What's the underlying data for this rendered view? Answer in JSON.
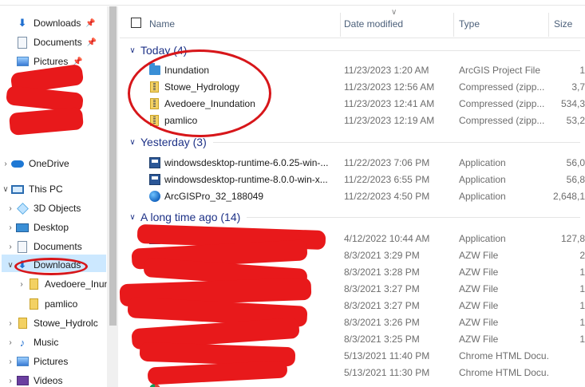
{
  "navigation": {
    "quick_access": [
      {
        "label": "Downloads",
        "icon": "download-arrow-icon",
        "pinned": true
      },
      {
        "label": "Documents",
        "icon": "document-icon",
        "pinned": true
      },
      {
        "label": "Pictures",
        "icon": "picture-icon",
        "pinned": true
      }
    ],
    "onedrive": {
      "label": "OneDrive",
      "icon": "cloud-icon"
    },
    "this_pc": {
      "label": "This PC",
      "icon": "computer-icon"
    },
    "this_pc_items": [
      {
        "label": "3D Objects",
        "icon": "cube-icon"
      },
      {
        "label": "Desktop",
        "icon": "desktop-icon"
      },
      {
        "label": "Documents",
        "icon": "document-icon"
      },
      {
        "label": "Downloads",
        "icon": "download-arrow-icon",
        "selected": true
      },
      {
        "label": "Avedoere_Inun",
        "icon": "zip-folder-icon"
      },
      {
        "label": "pamlico",
        "icon": "zip-folder-icon"
      },
      {
        "label": "Stowe_Hydrolc",
        "icon": "zip-folder-icon"
      },
      {
        "label": "Music",
        "icon": "music-note-icon"
      },
      {
        "label": "Pictures",
        "icon": "picture-icon"
      },
      {
        "label": "Videos",
        "icon": "video-icon"
      }
    ]
  },
  "columns": {
    "name": "Name",
    "date_modified": "Date modified",
    "type": "Type",
    "size": "Size"
  },
  "groups": [
    {
      "title": "Today (4)",
      "rows": [
        {
          "name": "Inundation",
          "date": "11/23/2023 1:20 AM",
          "type": "ArcGIS Project File",
          "size": "1",
          "icon": "arcgis-project-icon"
        },
        {
          "name": "Stowe_Hydrology",
          "date": "11/23/2023 12:56 AM",
          "type": "Compressed (zipp...",
          "size": "3,7",
          "icon": "zip-folder-icon"
        },
        {
          "name": "Avedoere_Inundation",
          "date": "11/23/2023 12:41 AM",
          "type": "Compressed (zipp...",
          "size": "534,3",
          "icon": "zip-folder-icon"
        },
        {
          "name": "pamlico",
          "date": "11/23/2023 12:19 AM",
          "type": "Compressed (zipp...",
          "size": "53,2",
          "icon": "zip-folder-icon"
        }
      ]
    },
    {
      "title": "Yesterday (3)",
      "rows": [
        {
          "name": "windowsdesktop-runtime-6.0.25-win-...",
          "date": "11/22/2023 7:06 PM",
          "type": "Application",
          "size": "56,0",
          "icon": "installer-icon"
        },
        {
          "name": "windowsdesktop-runtime-8.0.0-win-x...",
          "date": "11/22/2023 6:55 PM",
          "type": "Application",
          "size": "56,8",
          "icon": "installer-icon"
        },
        {
          "name": "ArcGISPro_32_188049",
          "date": "11/22/2023 4:50 PM",
          "type": "Application",
          "size": "2,648,1",
          "icon": "arcgis-globe-icon"
        }
      ]
    },
    {
      "title": "A long time ago (14)",
      "rows": [
        {
          "name": "",
          "date": "4/12/2022 10:44 AM",
          "type": "Application",
          "size": "127,8",
          "icon": "installer-icon"
        },
        {
          "name": "",
          "date": "8/3/2021 3:29 PM",
          "type": "AZW File",
          "size": "2",
          "icon": "file-icon"
        },
        {
          "name": "",
          "date": "8/3/2021 3:28 PM",
          "type": "AZW File",
          "size": "1",
          "icon": "file-icon"
        },
        {
          "name": "",
          "date": "8/3/2021 3:27 PM",
          "type": "AZW File",
          "size": "1",
          "icon": "file-icon"
        },
        {
          "name": "",
          "date": "8/3/2021 3:27 PM",
          "type": "AZW File",
          "size": "1",
          "icon": "file-icon"
        },
        {
          "name": "",
          "date": "8/3/2021 3:26 PM",
          "type": "AZW File",
          "size": "1",
          "icon": "file-icon"
        },
        {
          "name": "",
          "date": "8/3/2021 3:25 PM",
          "type": "AZW File",
          "size": "1",
          "icon": "file-icon"
        },
        {
          "name": "",
          "date": "5/13/2021 11:40 PM",
          "type": "Chrome HTML Docu...",
          "size": "",
          "icon": "chrome-icon"
        },
        {
          "name": "",
          "date": "5/13/2021 11:30 PM",
          "type": "Chrome HTML Docu...",
          "size": "",
          "icon": "chrome-icon"
        }
      ]
    }
  ],
  "colors": {
    "group_header": "#1e3287",
    "column_header": "#4c607a",
    "selection": "#cce8ff",
    "redaction": "#e8191b"
  }
}
